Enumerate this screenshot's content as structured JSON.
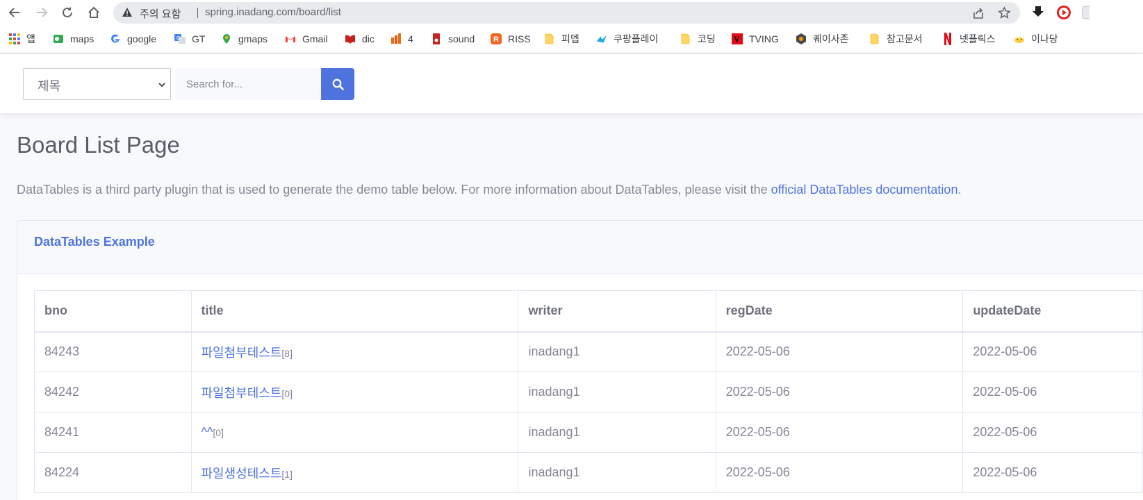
{
  "browser": {
    "address_warning": "주의 요함",
    "url": "spring.inadang.com/board/list"
  },
  "bookmarks": [
    {
      "label": "앱",
      "icon": "apps-grid-icon"
    },
    {
      "label": "maps",
      "icon": "maps-icon"
    },
    {
      "label": "google",
      "icon": "google-icon"
    },
    {
      "label": "GT",
      "icon": "translate-icon"
    },
    {
      "label": "gmaps",
      "icon": "map-pin-icon"
    },
    {
      "label": "Gmail",
      "icon": "gmail-icon"
    },
    {
      "label": "dic",
      "icon": "dictionary-icon"
    },
    {
      "label": "4",
      "icon": "office-icon"
    },
    {
      "label": "sound",
      "icon": "sound-icon"
    },
    {
      "label": "RISS",
      "icon": "riss-icon"
    },
    {
      "label": "피뎁",
      "icon": "folder-icon"
    },
    {
      "label": "쿠팡플레이",
      "icon": "coupang-play-icon"
    },
    {
      "label": "코딩",
      "icon": "folder-icon"
    },
    {
      "label": "TVING",
      "icon": "tving-icon"
    },
    {
      "label": "퀘이사존",
      "icon": "quasarzone-icon"
    },
    {
      "label": "참고문서",
      "icon": "folder-icon"
    },
    {
      "label": "넷플릭스",
      "icon": "netflix-icon"
    },
    {
      "label": "이나당",
      "icon": "chick-icon"
    }
  ],
  "search": {
    "select_value": "제목",
    "placeholder": "Search for..."
  },
  "page": {
    "title": "Board List Page",
    "description": "DataTables is a third party plugin that is used to generate the demo table below. For more information about DataTables, please visit the ",
    "link_text": "official DataTables documentation",
    "description_end": "."
  },
  "card": {
    "title": "DataTables Example"
  },
  "table": {
    "headers": [
      "bno",
      "title",
      "writer",
      "regDate",
      "updateDate"
    ],
    "rows": [
      {
        "bno": "84243",
        "title": "파일첨부테스트",
        "replies": "[8]",
        "writer": "inadang1",
        "regDate": "2022-05-06",
        "updateDate": "2022-05-06"
      },
      {
        "bno": "84242",
        "title": "파일첨부테스트",
        "replies": "[0]",
        "writer": "inadang1",
        "regDate": "2022-05-06",
        "updateDate": "2022-05-06"
      },
      {
        "bno": "84241",
        "title": "^^",
        "replies": "[0]",
        "writer": "inadang1",
        "regDate": "2022-05-06",
        "updateDate": "2022-05-06"
      },
      {
        "bno": "84224",
        "title": "파일생성테스트",
        "replies": "[1]",
        "writer": "inadang1",
        "regDate": "2022-05-06",
        "updateDate": "2022-05-06"
      }
    ]
  },
  "colors": {
    "primary": "#4e73df",
    "text_muted": "#858796",
    "heading": "#5a5c69",
    "background": "#f8f9fc"
  }
}
